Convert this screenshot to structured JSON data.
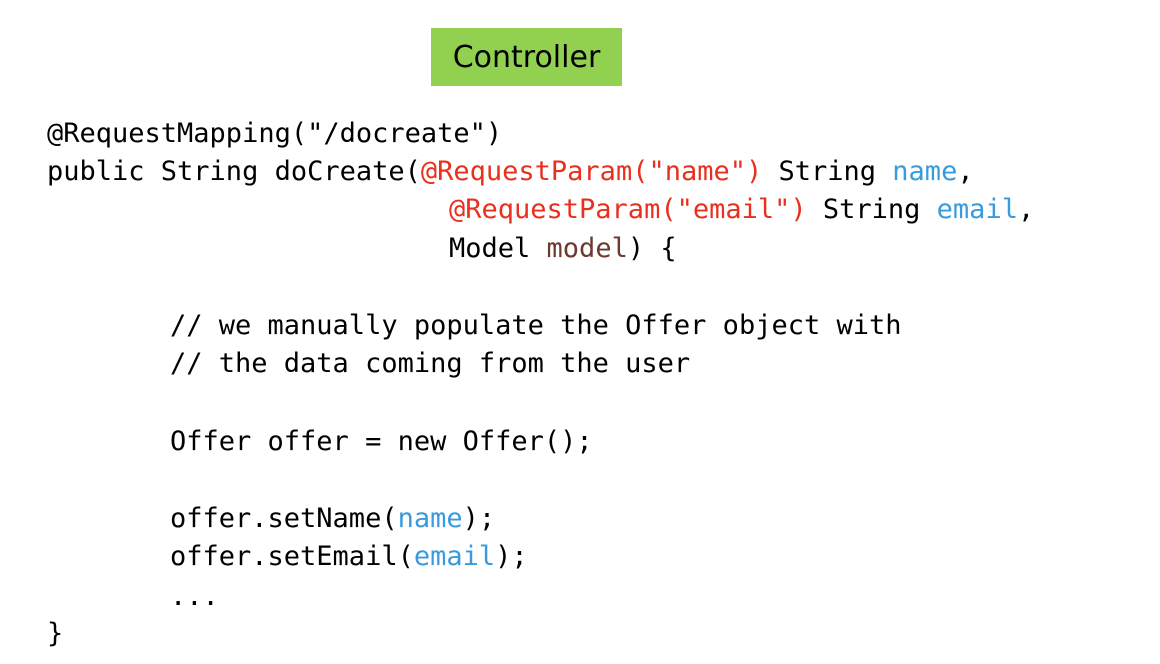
{
  "slide": {
    "title": "Controller"
  },
  "code": {
    "l1": "@RequestMapping(\"/docreate\")",
    "l2_a": "public String doCreate(",
    "l2_b": "@RequestParam(\"name\")",
    "l2_c": " String ",
    "l2_d": "name",
    "l2_e": ",",
    "l3_a": "@RequestParam(\"email\")",
    "l3_b": " String ",
    "l3_c": "email",
    "l3_d": ",",
    "l4_a": "Model ",
    "l4_b": "model",
    "l4_c": ") {",
    "l5": "// we manually populate the Offer object with",
    "l6": "// the data coming from the user",
    "l7": "Offer offer = new Offer();",
    "l8_a": "offer.setName(",
    "l8_b": "name",
    "l8_c": ");",
    "l9_a": "offer.setEmail(",
    "l9_b": "email",
    "l9_c": ");",
    "l10": "...",
    "l11": "}"
  },
  "colors": {
    "title_bg": "#92d050",
    "annotation": "#e8301e",
    "param_name": "#3a9bdc",
    "model_var": "#6b3a2e"
  }
}
